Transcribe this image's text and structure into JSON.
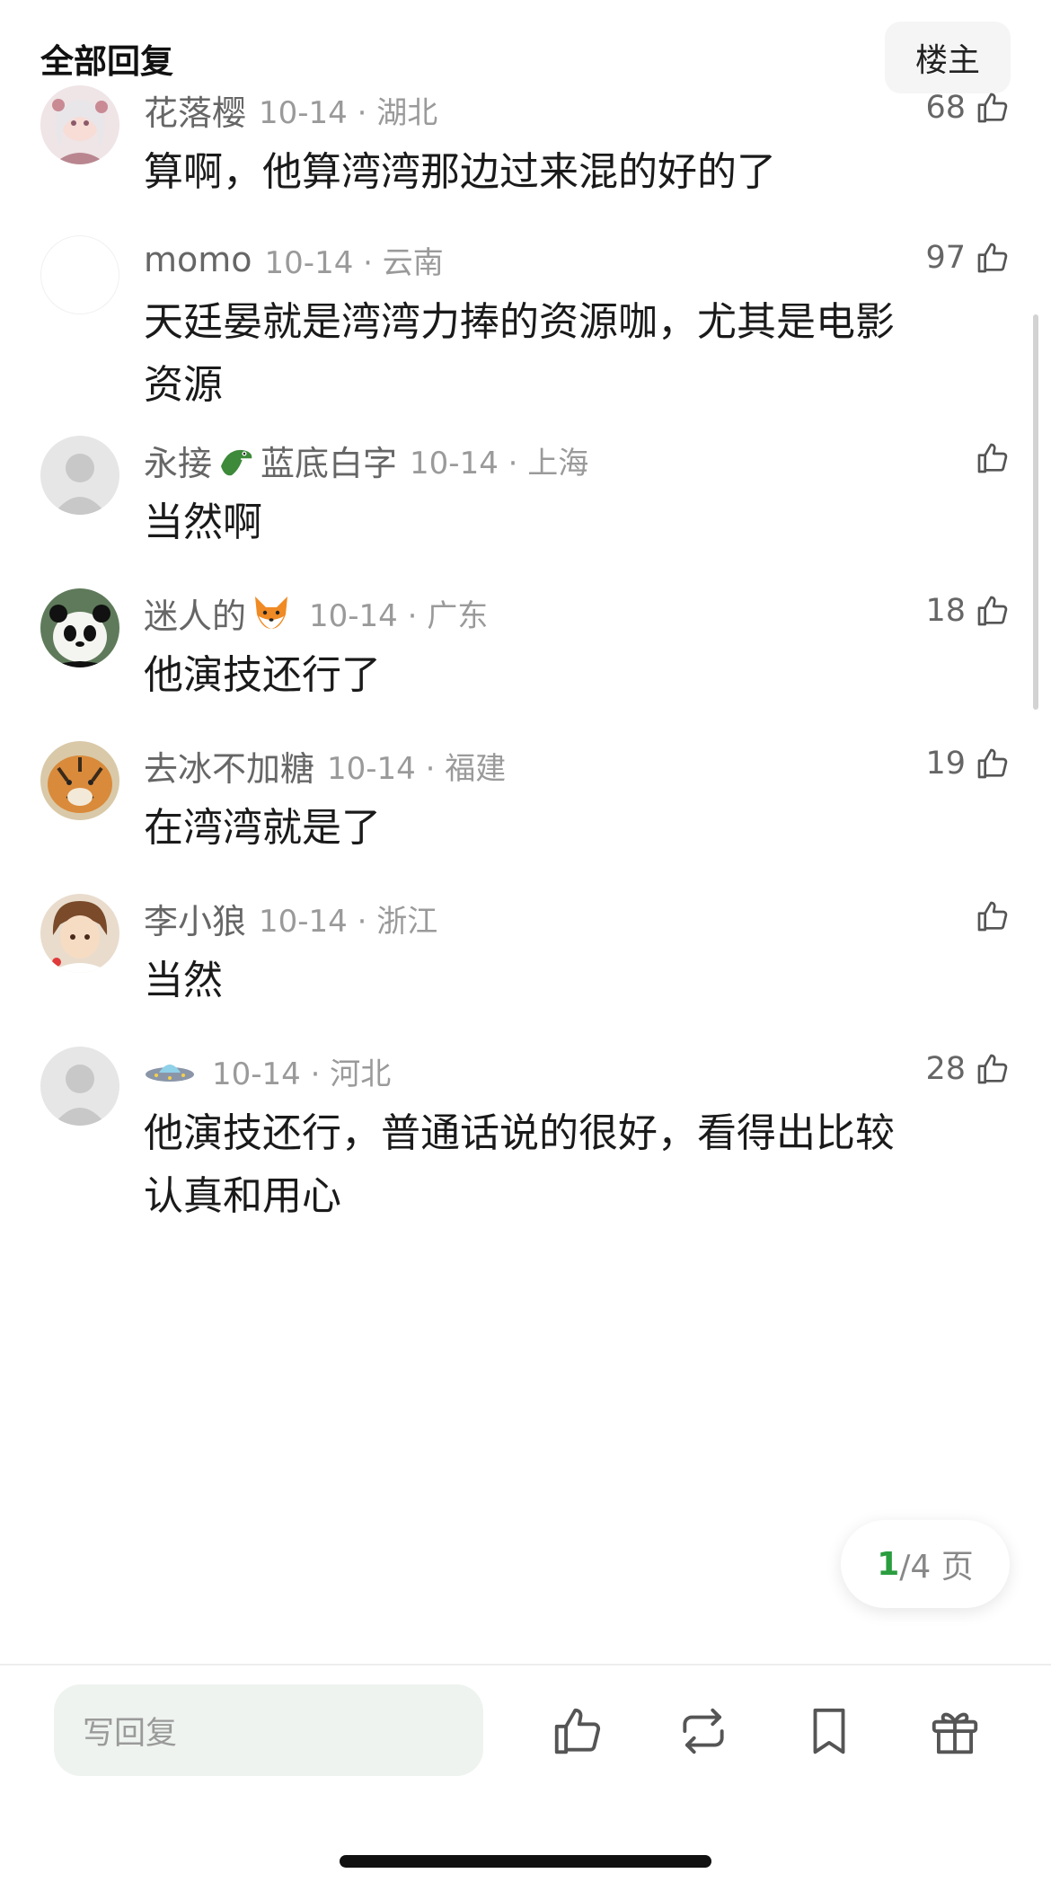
{
  "header": {
    "title": "全部回复",
    "owner_label": "楼主"
  },
  "comments": [
    {
      "name": "花落樱",
      "date": "10-14 · 湖北",
      "likes": "68",
      "lines": [
        "算啊，他算湾湾那边过来混的好的了"
      ]
    },
    {
      "name": "momo",
      "date": "10-14 · 云南",
      "likes": "97",
      "lines": [
        "天廷晏就是湾湾力捧的资源咖，尤其是电影",
        "资源"
      ]
    },
    {
      "name": "永接",
      "name_suffix": "蓝底白字",
      "emoji": "crocodile",
      "date": "10-14 · 上海",
      "likes": "",
      "lines": [
        "当然啊"
      ]
    },
    {
      "name": "迷人的",
      "emoji": "fox",
      "date": "10-14 · 广东",
      "likes": "18",
      "lines": [
        "他演技还行了"
      ]
    },
    {
      "name": "去冰不加糖",
      "date": "10-14 · 福建",
      "likes": "19",
      "lines": [
        "在湾湾就是了"
      ]
    },
    {
      "name": "李小狼",
      "date": "10-14 · 浙江",
      "likes": "",
      "lines": [
        "当然"
      ]
    },
    {
      "name": "",
      "emoji": "ufo",
      "date": "10-14 · 河北",
      "likes": "28",
      "lines": [
        "他演技还行，普通话说的很好，看得出比较",
        "认真和用心"
      ]
    }
  ],
  "pager": {
    "current": "1",
    "total_text": "/4 页"
  },
  "footer": {
    "reply_placeholder": "写回复"
  },
  "colors": {
    "accent_green": "#2a9d3f",
    "muted_text": "#9a9a9a"
  }
}
